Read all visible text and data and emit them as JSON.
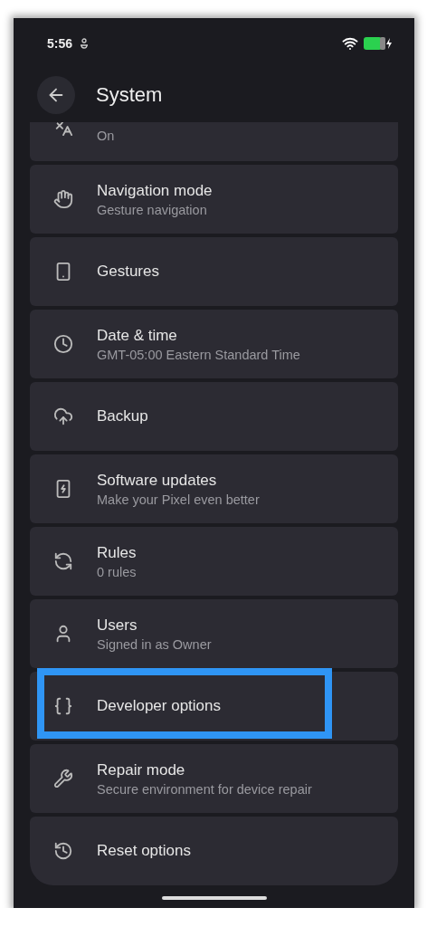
{
  "status_bar": {
    "time": "5:56"
  },
  "header": {
    "title": "System"
  },
  "items": [
    {
      "subtitle": "On",
      "highlighted": false
    },
    {
      "title": "Navigation mode",
      "subtitle": "Gesture navigation",
      "highlighted": false
    },
    {
      "title": "Gestures",
      "highlighted": false
    },
    {
      "title": "Date & time",
      "subtitle": "GMT-05:00 Eastern Standard Time",
      "highlighted": false
    },
    {
      "title": "Backup",
      "highlighted": false
    },
    {
      "title": "Software updates",
      "subtitle": "Make your Pixel even better",
      "highlighted": false
    },
    {
      "title": "Rules",
      "subtitle": "0 rules",
      "highlighted": false
    },
    {
      "title": "Users",
      "subtitle": "Signed in as Owner",
      "highlighted": false
    },
    {
      "title": "Developer options",
      "highlighted": true
    },
    {
      "title": "Repair mode",
      "subtitle": "Secure environment for device repair",
      "highlighted": false
    },
    {
      "title": "Reset options",
      "highlighted": false
    }
  ]
}
